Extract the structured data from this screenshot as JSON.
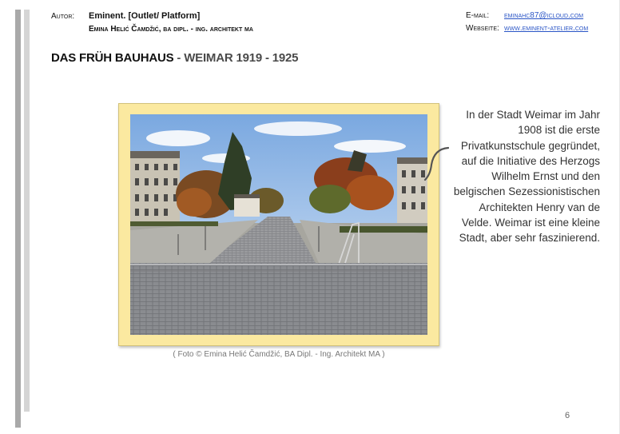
{
  "header": {
    "author_label": "Autor:",
    "author_name": "Eminent. [Outlet/ Platform]",
    "author_sub": "Emina Helić Čamdžić, ba dipl. - ing. architekt ma",
    "email_label": "E-mail:",
    "email_value": "eminahc87@icloud.com",
    "web_label": "Webseite:",
    "web_value": "www.eminent-atelier.com"
  },
  "title": {
    "part1": "DAS FRÜH BAUHAUS",
    "sep": " - ",
    "part2": "WEIMAR 1919 - 1925"
  },
  "figure": {
    "caption": "( Foto © Emina Helić Čamdžić, BA Dipl. - Ing. Architekt MA )"
  },
  "body": {
    "text": "In der Stadt Weimar im Jahr 1908 ist die erste Privatkunstschule gegründet, auf die Initiative des Herzogs Wilhelm Ernst und den belgischen Sezessionistischen Architekten Henry van de Velde. Weimar ist eine kleine Stadt, aber sehr faszinierend."
  },
  "page_number": "6",
  "colors": {
    "frame_fill": "#fbe9a0",
    "link": "#2a55c6",
    "bar_dark": "#a9a9a9",
    "bar_light": "#d5d5d5"
  }
}
